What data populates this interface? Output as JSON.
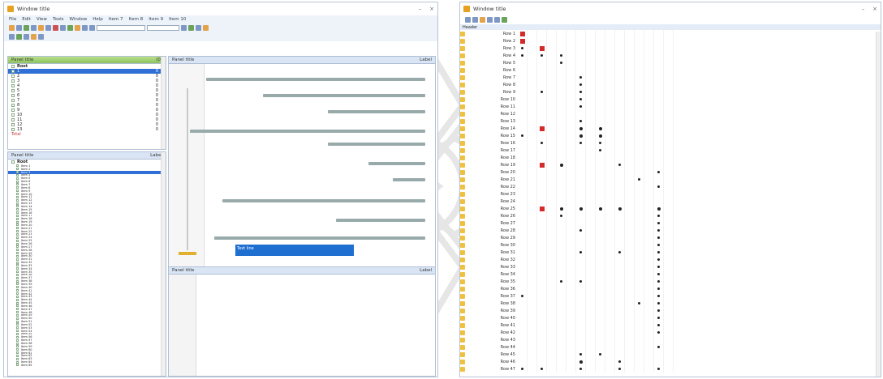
{
  "left_window": {
    "title": "Window title",
    "menu": [
      "File",
      "Edit",
      "View",
      "Tools",
      "Window",
      "Help",
      "Item 7",
      "Item 8",
      "Item 9",
      "Item 10"
    ],
    "codes_panel": {
      "title": "Panel title",
      "count": "(0)"
    },
    "documents_panel": {
      "title": "Panel title",
      "right": "Label"
    },
    "doc_tree": {
      "root": "Root",
      "items": [
        {
          "label": "1",
          "n": "0"
        },
        {
          "label": "2",
          "n": "0"
        },
        {
          "label": "3",
          "n": "0"
        },
        {
          "label": "4",
          "n": "0"
        },
        {
          "label": "5",
          "n": "0"
        },
        {
          "label": "6",
          "n": "0"
        },
        {
          "label": "7",
          "n": "0"
        },
        {
          "label": "8",
          "n": "0"
        },
        {
          "label": "9",
          "n": "0"
        },
        {
          "label": "10",
          "n": "0"
        },
        {
          "label": "11",
          "n": "0"
        },
        {
          "label": "12",
          "n": "0"
        },
        {
          "label": "13",
          "n": "0"
        }
      ],
      "footer": "Total"
    },
    "code_system_panel": {
      "title": "Panel title",
      "right": "Label"
    },
    "code_root": "Root",
    "codes": [
      "Item 1",
      "Item 2",
      "Item 3",
      "Item 4",
      "Item 5",
      "Item 6",
      "Item 7",
      "Item 8",
      "Item 9",
      "Item 10",
      "Item 11",
      "Item 12",
      "Item 13",
      "Item 14",
      "Item 15",
      "Item 16",
      "Item 17",
      "Item 18",
      "Item 19",
      "Item 20",
      "Item 21",
      "Item 22",
      "Item 23",
      "Item 24",
      "Item 25",
      "Item 26",
      "Item 27",
      "Item 28",
      "Item 29",
      "Item 30",
      "Item 31",
      "Item 32",
      "Item 33",
      "Item 34",
      "Item 35",
      "Item 36",
      "Item 37",
      "Item 38",
      "Item 39",
      "Item 40",
      "Item 41",
      "Item 42",
      "Item 43",
      "Item 44",
      "Item 45",
      "Item 46",
      "Item 47",
      "Item 48",
      "Item 49",
      "Item 50",
      "Item 51",
      "Item 52",
      "Item 53",
      "Item 54",
      "Item 55",
      "Item 56",
      "Item 57",
      "Item 58",
      "Item 59",
      "Item 60",
      "Item 61",
      "Item 62",
      "Item 63",
      "Item 64",
      "Item 65"
    ],
    "retrieved_panel": {
      "title": "Panel title",
      "right": "Label"
    },
    "highlight_text": "Text line"
  },
  "matrix_window": {
    "title": "Window title",
    "header": "Header",
    "rows": [
      "Row 1",
      "Row 2",
      "Row 3",
      "Row 4",
      "Row 5",
      "Row 6",
      "Row 7",
      "Row 8",
      "Row 9",
      "Row 10",
      "Row 11",
      "Row 12",
      "Row 13",
      "Row 14",
      "Row 15",
      "Row 16",
      "Row 17",
      "Row 18",
      "Row 19",
      "Row 20",
      "Row 21",
      "Row 22",
      "Row 23",
      "Row 24",
      "Row 25",
      "Row 26",
      "Row 27",
      "Row 28",
      "Row 29",
      "Row 30",
      "Row 31",
      "Row 32",
      "Row 33",
      "Row 34",
      "Row 35",
      "Row 36",
      "Row 37",
      "Row 38",
      "Row 39",
      "Row 40",
      "Row 41",
      "Row 42",
      "Row 43",
      "Row 44",
      "Row 45",
      "Row 46",
      "Row 47"
    ],
    "cells": [
      [
        [
          0,
          "r",
          3
        ]
      ],
      [
        [
          0,
          "r",
          3
        ]
      ],
      [
        [
          2,
          "r",
          3
        ],
        [
          0,
          "k",
          1
        ]
      ],
      [
        [
          0,
          "k",
          1
        ],
        [
          2,
          "k",
          1
        ],
        [
          4,
          "k",
          1
        ]
      ],
      [
        [
          4,
          "k",
          1
        ]
      ],
      [],
      [
        [
          6,
          "k",
          1
        ]
      ],
      [
        [
          6,
          "k",
          1
        ]
      ],
      [
        [
          2,
          "k",
          1
        ],
        [
          6,
          "k",
          1
        ]
      ],
      [
        [
          6,
          "k",
          1
        ]
      ],
      [
        [
          6,
          "k",
          1
        ]
      ],
      [],
      [
        [
          6,
          "k",
          1
        ]
      ],
      [
        [
          2,
          "r",
          3
        ],
        [
          6,
          "k",
          2
        ],
        [
          8,
          "k",
          2
        ]
      ],
      [
        [
          0,
          "k",
          1
        ],
        [
          6,
          "k",
          2
        ],
        [
          8,
          "k",
          2
        ]
      ],
      [
        [
          2,
          "k",
          1
        ],
        [
          6,
          "k",
          1
        ],
        [
          8,
          "k",
          1
        ]
      ],
      [
        [
          8,
          "k",
          1
        ]
      ],
      [],
      [
        [
          2,
          "r",
          3
        ],
        [
          4,
          "k",
          2
        ],
        [
          10,
          "k",
          1
        ]
      ],
      [
        [
          14,
          "k",
          1
        ]
      ],
      [
        [
          12,
          "k",
          1
        ]
      ],
      [
        [
          14,
          "k",
          1
        ]
      ],
      [],
      [],
      [
        [
          2,
          "r",
          3
        ],
        [
          4,
          "k",
          2
        ],
        [
          6,
          "k",
          2
        ],
        [
          8,
          "k",
          2
        ],
        [
          10,
          "k",
          2
        ],
        [
          14,
          "k",
          2
        ]
      ],
      [
        [
          4,
          "k",
          1
        ],
        [
          14,
          "k",
          1
        ]
      ],
      [
        [
          14,
          "k",
          1
        ]
      ],
      [
        [
          6,
          "k",
          1
        ],
        [
          14,
          "k",
          1
        ]
      ],
      [
        [
          14,
          "k",
          1
        ]
      ],
      [
        [
          14,
          "k",
          1
        ]
      ],
      [
        [
          6,
          "k",
          1
        ],
        [
          10,
          "k",
          1
        ],
        [
          14,
          "k",
          1
        ]
      ],
      [
        [
          14,
          "k",
          1
        ]
      ],
      [
        [
          14,
          "k",
          1
        ]
      ],
      [
        [
          14,
          "k",
          1
        ]
      ],
      [
        [
          4,
          "k",
          1
        ],
        [
          6,
          "k",
          1
        ],
        [
          14,
          "k",
          1
        ]
      ],
      [
        [
          14,
          "k",
          1
        ]
      ],
      [
        [
          0,
          "k",
          1
        ],
        [
          14,
          "k",
          1
        ]
      ],
      [
        [
          12,
          "k",
          1
        ],
        [
          14,
          "k",
          1
        ]
      ],
      [
        [
          14,
          "k",
          1
        ]
      ],
      [
        [
          14,
          "k",
          1
        ]
      ],
      [
        [
          14,
          "k",
          1
        ]
      ],
      [
        [
          14,
          "k",
          1
        ]
      ],
      [],
      [
        [
          14,
          "k",
          1
        ]
      ],
      [
        [
          6,
          "k",
          1
        ],
        [
          8,
          "k",
          1
        ]
      ],
      [
        [
          6,
          "k",
          2
        ],
        [
          10,
          "k",
          1
        ]
      ],
      [
        [
          0,
          "k",
          1
        ],
        [
          2,
          "k",
          1
        ],
        [
          6,
          "k",
          1
        ],
        [
          10,
          "k",
          1
        ],
        [
          14,
          "k",
          1
        ]
      ]
    ]
  },
  "colors": {
    "accent": "#2f6fd6",
    "green": "#8cc25e",
    "red": "#d32a2a",
    "dot": "#222"
  }
}
